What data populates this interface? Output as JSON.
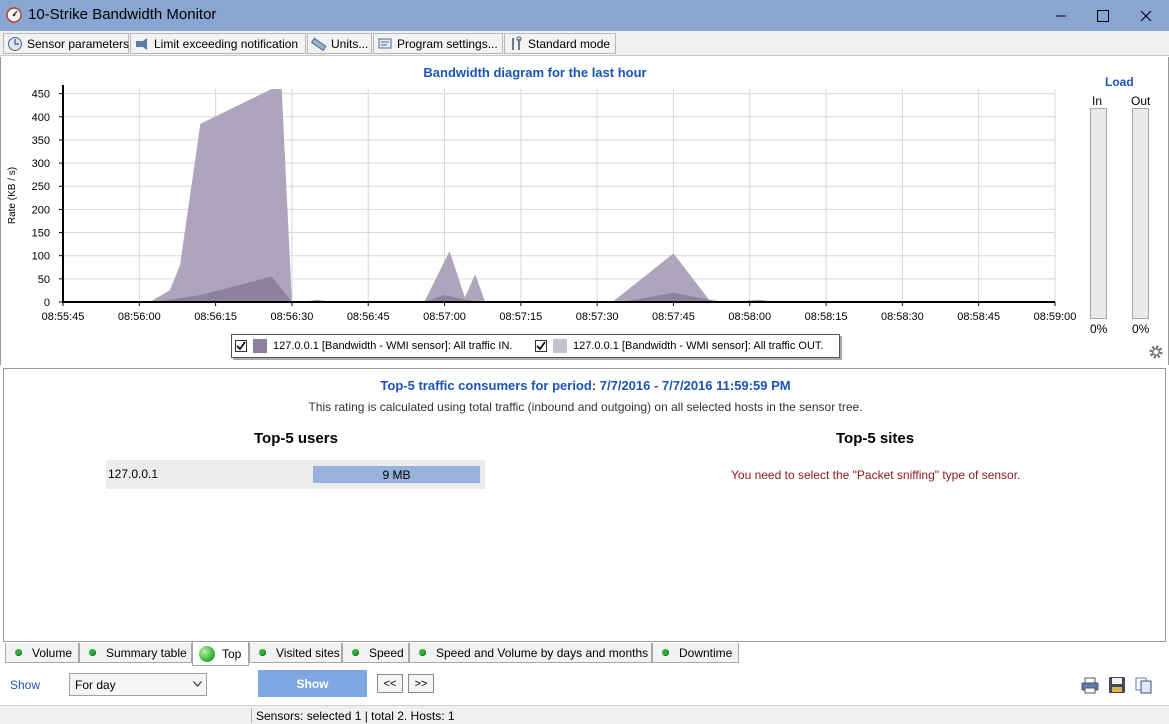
{
  "window": {
    "title": "10-Strike Bandwidth Monitor",
    "controls": [
      "minimize",
      "maximize",
      "close"
    ]
  },
  "toolbar": {
    "buttons": [
      {
        "label": "Sensor parameters",
        "icon": "sensor-icon"
      },
      {
        "label": "Limit exceeding notification",
        "icon": "notification-icon"
      },
      {
        "label": "Units...",
        "icon": "ruler-icon"
      },
      {
        "label": "Program settings...",
        "icon": "settings-icon"
      },
      {
        "label": "Standard mode",
        "icon": "tools-icon"
      }
    ]
  },
  "chart_data": {
    "type": "area",
    "title": "Bandwidth diagram for the last hour",
    "ylabel": "Rate (KB / s)",
    "xlabel": "",
    "ylim": [
      0,
      460
    ],
    "yticks": [
      0,
      50,
      100,
      150,
      200,
      250,
      300,
      350,
      400,
      450
    ],
    "xticks": [
      "08:55:45",
      "08:56:00",
      "08:56:15",
      "08:56:30",
      "08:56:45",
      "08:57:00",
      "08:57:15",
      "08:57:30",
      "08:57:45",
      "08:58:00",
      "08:58:15",
      "08:58:30",
      "08:58:45",
      "08:59:00"
    ],
    "grid": true,
    "legend_position": "bottom",
    "series": [
      {
        "name": "127.0.0.1 [Bandwidth - WMI sensor]: All traffic IN.",
        "color": "#aea5bd",
        "checked": true,
        "points": [
          [
            "08:55:45",
            0
          ],
          [
            "08:56:00",
            0
          ],
          [
            "08:56:02",
            0
          ],
          [
            "08:56:06",
            25
          ],
          [
            "08:56:08",
            80
          ],
          [
            "08:56:12",
            385
          ],
          [
            "08:56:26",
            460
          ],
          [
            "08:56:28",
            460
          ],
          [
            "08:56:30",
            0
          ],
          [
            "08:56:32",
            0
          ],
          [
            "08:56:35",
            5
          ],
          [
            "08:56:38",
            0
          ],
          [
            "08:56:56",
            0
          ],
          [
            "08:57:01",
            110
          ],
          [
            "08:57:04",
            10
          ],
          [
            "08:57:06",
            60
          ],
          [
            "08:57:08",
            0
          ],
          [
            "08:57:30",
            0
          ],
          [
            "08:57:33",
            0
          ],
          [
            "08:57:45",
            105
          ],
          [
            "08:57:52",
            5
          ],
          [
            "08:57:55",
            0
          ],
          [
            "08:58:02",
            5
          ],
          [
            "08:58:05",
            0
          ],
          [
            "08:59:00",
            0
          ]
        ]
      },
      {
        "name": "127.0.0.1 [Bandwidth - WMI sensor]: All traffic OUT.",
        "color": "#8d819f",
        "checked": true,
        "points": [
          [
            "08:55:45",
            0
          ],
          [
            "08:56:02",
            0
          ],
          [
            "08:56:06",
            5
          ],
          [
            "08:56:12",
            15
          ],
          [
            "08:56:26",
            55
          ],
          [
            "08:56:30",
            0
          ],
          [
            "08:56:56",
            0
          ],
          [
            "08:57:00",
            15
          ],
          [
            "08:57:04",
            5
          ],
          [
            "08:57:08",
            0
          ],
          [
            "08:57:35",
            0
          ],
          [
            "08:57:45",
            20
          ],
          [
            "08:57:52",
            5
          ],
          [
            "08:57:55",
            0
          ],
          [
            "08:59:00",
            0
          ]
        ]
      }
    ]
  },
  "load": {
    "title": "Load",
    "in_label": "In",
    "out_label": "Out",
    "in_value": "0%",
    "out_value": "0%",
    "in_fraction": 0,
    "out_fraction": 0
  },
  "top": {
    "title": "Top-5 traffic consumers for period: 7/7/2016 - 7/7/2016 11:59:59 PM",
    "note": "This rating is calculated using total traffic (inbound and outgoing) on all selected hosts in the sensor tree.",
    "users_heading": "Top-5 users",
    "sites_heading": "Top-5 sites",
    "users": [
      {
        "host": "127.0.0.1",
        "value": "9 MB",
        "fraction": 1.0
      }
    ],
    "sites_message": "You need to select the \"Packet sniffing\" type of sensor."
  },
  "tabs": [
    {
      "label": "Volume",
      "active": false
    },
    {
      "label": "Summary table",
      "active": false
    },
    {
      "label": "Top",
      "active": true
    },
    {
      "label": "Visited sites",
      "active": false
    },
    {
      "label": "Speed",
      "active": false
    },
    {
      "label": "Speed and Volume by days and months",
      "active": false
    },
    {
      "label": "Downtime",
      "active": false
    }
  ],
  "controls": {
    "show_label": "Show",
    "period_value": "For day",
    "show_button": "Show",
    "prev_button": "<<",
    "next_button": ">>"
  },
  "status": {
    "text": "Sensors: selected 1 | total 2. Hosts: 1"
  }
}
